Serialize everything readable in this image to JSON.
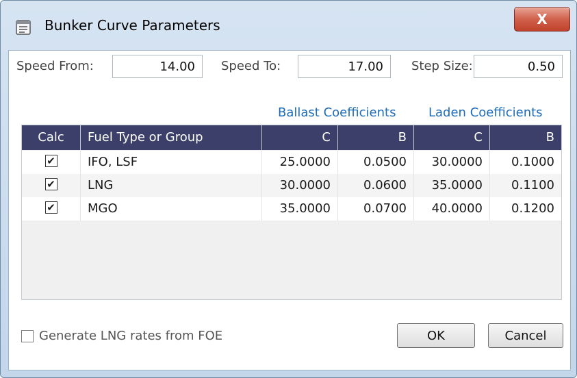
{
  "window": {
    "title": "Bunker Curve Parameters",
    "close_label": "X",
    "icons": {
      "app": "dialog-icon",
      "close": "close-icon"
    }
  },
  "speed": {
    "from_label": "Speed From:",
    "from_value": "14.00",
    "to_label": "Speed To:",
    "to_value": "17.00",
    "step_label": "Step Size:",
    "step_value": "0.50"
  },
  "coefficients": {
    "ballast_label": "Ballast Coefficients",
    "laden_label": "Laden Coefficients"
  },
  "grid": {
    "columns": [
      "Calc",
      "Fuel Type or Group",
      "C",
      "B",
      "C",
      "B"
    ],
    "rows": [
      {
        "calc": true,
        "fuel": "IFO, LSF",
        "ballast_c": "25.0000",
        "ballast_b": "0.0500",
        "laden_c": "30.0000",
        "laden_b": "0.1000"
      },
      {
        "calc": true,
        "fuel": "LNG",
        "ballast_c": "30.0000",
        "ballast_b": "0.0600",
        "laden_c": "35.0000",
        "laden_b": "0.1100"
      },
      {
        "calc": true,
        "fuel": "MGO",
        "ballast_c": "35.0000",
        "ballast_b": "0.0700",
        "laden_c": "40.0000",
        "laden_b": "0.1200"
      }
    ],
    "header_color": "#3c3f6a",
    "alt_row_color": "#f4f4f4"
  },
  "footer": {
    "foe_checkbox_label": "Generate LNG rates from FOE",
    "foe_checked": false,
    "ok_label": "OK",
    "cancel_label": "Cancel"
  },
  "colors": {
    "accent": "#1e6bb8",
    "close_button": "#c9492f",
    "window_frame": "#c9daec"
  }
}
